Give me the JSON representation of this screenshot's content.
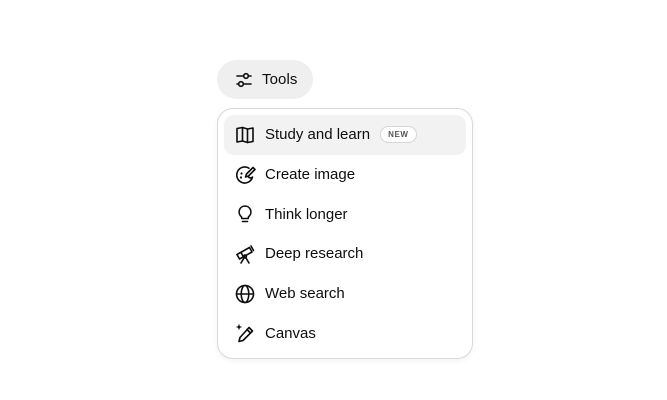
{
  "tools_button": {
    "label": "Tools",
    "icon": "sliders-icon"
  },
  "menu": {
    "items": [
      {
        "label": "Study and learn",
        "icon": "book-open-icon",
        "badge": "NEW",
        "highlighted": true
      },
      {
        "label": "Create image",
        "icon": "palette-icon"
      },
      {
        "label": "Think longer",
        "icon": "lightbulb-icon"
      },
      {
        "label": "Deep research",
        "icon": "telescope-icon"
      },
      {
        "label": "Web search",
        "icon": "globe-icon"
      },
      {
        "label": "Canvas",
        "icon": "pencil-sparkle-icon"
      }
    ]
  },
  "colors": {
    "background": "#ffffff",
    "button_bg": "#efefef",
    "highlight_bg": "#f2f2f2",
    "border": "#d9d9d9",
    "text": "#0d0d0d"
  }
}
